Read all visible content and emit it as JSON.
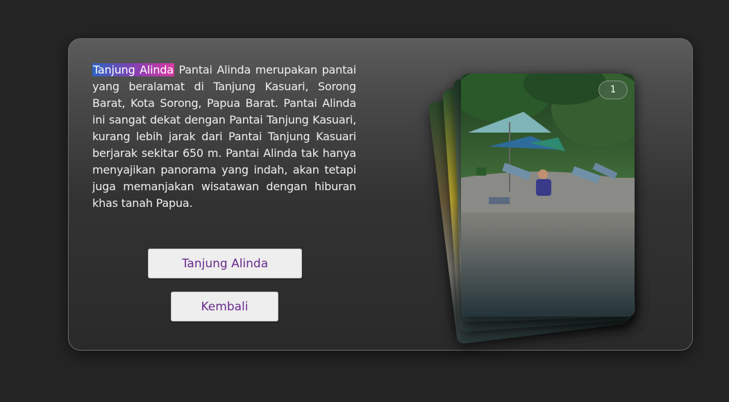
{
  "content": {
    "highlight": "Tanjung Alinda",
    "description": "Pantai Alinda merupakan pantai yang beralamat di Tanjung Kasuari, Sorong Barat, Kota Sorong, Papua Barat. Pantai Alinda ini sangat dekat dengan Pantai Tanjung Kasuari, kurang lebih jarak dari Pantai Tanjung Kasuari berjarak sekitar 650 m. Pantai Alinda tak hanya menyajikan panorama yang indah, akan tetapi juga memanjakan wisatawan dengan hiburan khas tanah Papua."
  },
  "buttons": {
    "primary_label": "Tanjung Alinda",
    "back_label": "Kembali"
  },
  "gallery": {
    "badge": "1"
  },
  "colors": {
    "button_text": "#6a2a8e",
    "highlight_start": "#2e64c0",
    "highlight_end": "#d83aa4"
  }
}
